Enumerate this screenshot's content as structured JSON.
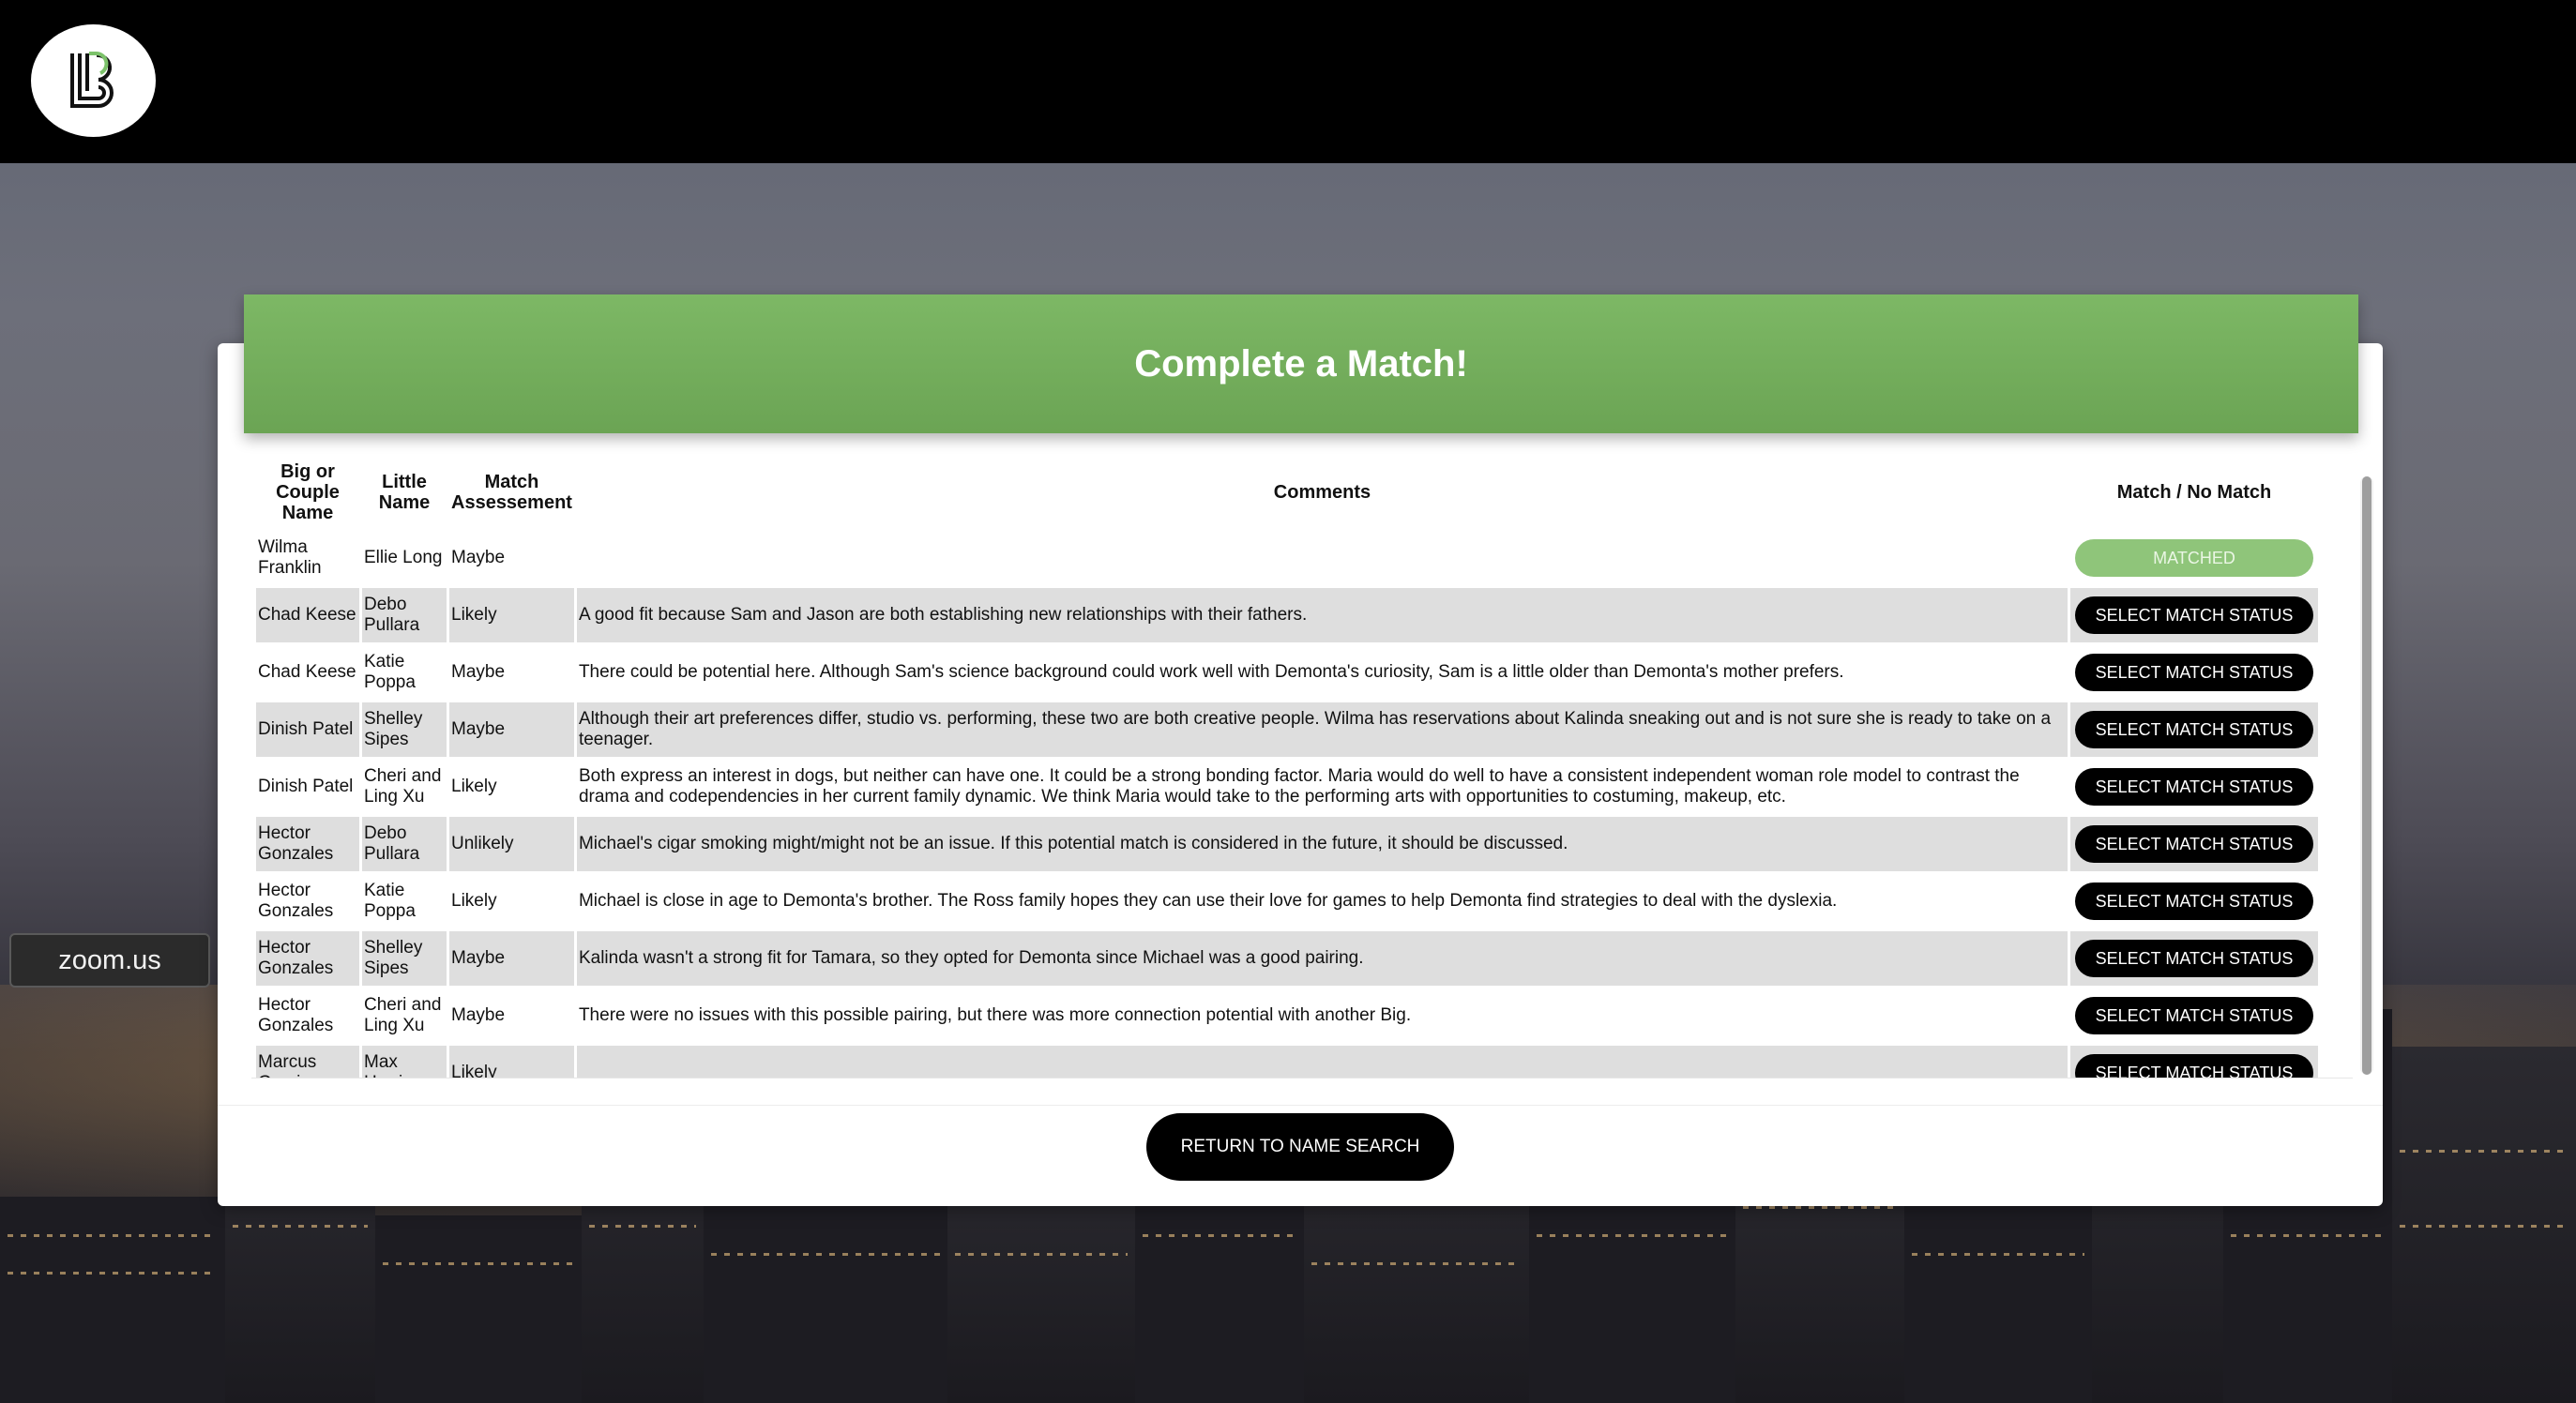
{
  "header": {
    "logo_icon": "bb-logo-icon"
  },
  "overlay": {
    "zoom_label": "zoom.us"
  },
  "card": {
    "title": "Complete a Match!",
    "columns": {
      "big": "Big or Couple Name",
      "little": "Little Name",
      "assessment": "Match Assessement",
      "comments": "Comments",
      "action": "Match / No Match"
    },
    "rows": [
      {
        "big": "Wilma Franklin",
        "little": "Ellie Long",
        "assessment": "Maybe",
        "comments": "",
        "action": "MATCHED",
        "matched": true
      },
      {
        "big": "Chad Keese",
        "little": "Debo Pullara",
        "assessment": "Likely",
        "comments": "A good fit because Sam and Jason are both establishing new relationships with their fathers.",
        "action": "SELECT MATCH STATUS"
      },
      {
        "big": "Chad Keese",
        "little": "Katie Poppa",
        "assessment": "Maybe",
        "comments": "There could be potential here. Although Sam's science background could work well with Demonta's curiosity, Sam is a little older than Demonta's mother prefers.",
        "action": "SELECT MATCH STATUS"
      },
      {
        "big": "Dinish Patel",
        "little": "Shelley Sipes",
        "assessment": "Maybe",
        "comments": "Although their art preferences differ, studio vs. performing, these two are both creative people. Wilma has reservations about Kalinda sneaking out and is not sure she is ready to take on a teenager.",
        "action": "SELECT MATCH STATUS"
      },
      {
        "big": "Dinish Patel",
        "little": "Cheri and Ling Xu",
        "assessment": "Likely",
        "comments": "Both express an interest in dogs, but neither can have one. It could be a strong bonding factor. Maria would do well to have a consistent independent woman role model to contrast the drama and codependencies in her current family dynamic. We think Maria would take to the performing arts with opportunities to costuming, makeup, etc.",
        "action": "SELECT MATCH STATUS"
      },
      {
        "big": "Hector Gonzales",
        "little": "Debo Pullara",
        "assessment": "Unlikely",
        "comments": "Michael's cigar smoking might/might not be an issue. If this potential match is considered in the future, it should be discussed.",
        "action": "SELECT MATCH STATUS"
      },
      {
        "big": "Hector Gonzales",
        "little": "Katie Poppa",
        "assessment": "Likely",
        "comments": "Michael is close in age to Demonta's brother. The Ross family hopes they can use their love for games to help Demonta find strategies to deal with the dyslexia.",
        "action": "SELECT MATCH STATUS"
      },
      {
        "big": "Hector Gonzales",
        "little": "Shelley Sipes",
        "assessment": "Maybe",
        "comments": "Kalinda wasn't a strong fit for Tamara, so they opted for Demonta since Michael was a good pairing.",
        "action": "SELECT MATCH STATUS"
      },
      {
        "big": "Hector Gonzales",
        "little": "Cheri and Ling Xu",
        "assessment": "Maybe",
        "comments": "There were no issues with this possible pairing, but there was more connection potential with another Big.",
        "action": "SELECT MATCH STATUS"
      },
      {
        "big": "Marcus Garcia",
        "little": "Max Harris",
        "assessment": "Likely",
        "comments": "",
        "action": "SELECT MATCH STATUS"
      }
    ],
    "return_label": "RETURN TO NAME SEARCH"
  },
  "colors": {
    "header_green": "#73ad5c",
    "matched_green": "#8fc57a",
    "row_shade": "#dedede",
    "topbar": "#000000"
  }
}
